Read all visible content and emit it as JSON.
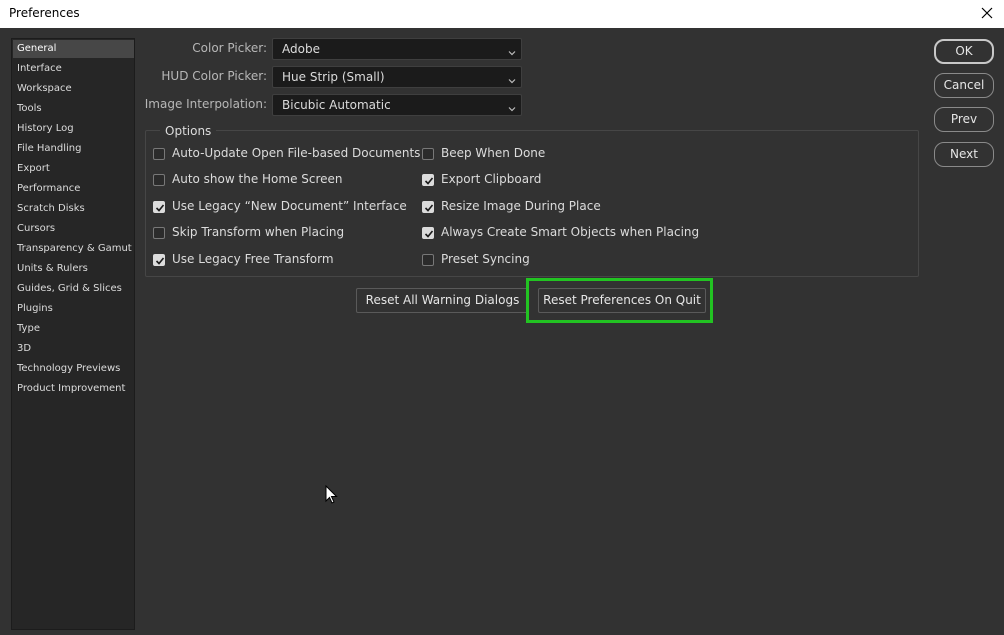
{
  "window": {
    "title": "Preferences"
  },
  "sidebar": {
    "items": [
      {
        "label": "General",
        "selected": true
      },
      {
        "label": "Interface"
      },
      {
        "label": "Workspace"
      },
      {
        "label": "Tools"
      },
      {
        "label": "History Log"
      },
      {
        "label": "File Handling"
      },
      {
        "label": "Export"
      },
      {
        "label": "Performance"
      },
      {
        "label": "Scratch Disks"
      },
      {
        "label": "Cursors"
      },
      {
        "label": "Transparency & Gamut"
      },
      {
        "label": "Units & Rulers"
      },
      {
        "label": "Guides, Grid & Slices"
      },
      {
        "label": "Plugins"
      },
      {
        "label": "Type"
      },
      {
        "label": "3D"
      },
      {
        "label": "Technology Previews"
      },
      {
        "label": "Product Improvement"
      }
    ]
  },
  "fields": {
    "color_picker": {
      "label": "Color Picker:",
      "value": "Adobe"
    },
    "hud_color_picker": {
      "label": "HUD Color Picker:",
      "value": "Hue Strip (Small)"
    },
    "image_interpolation": {
      "label": "Image Interpolation:",
      "value": "Bicubic Automatic"
    }
  },
  "options": {
    "title": "Options",
    "left": [
      {
        "label": "Auto-Update Open File-based Documents",
        "checked": false
      },
      {
        "label": "Auto show the Home Screen",
        "checked": false
      },
      {
        "label": "Use Legacy “New Document” Interface",
        "checked": true
      },
      {
        "label": "Skip Transform when Placing",
        "checked": false
      },
      {
        "label": "Use Legacy Free Transform",
        "checked": true
      }
    ],
    "right": [
      {
        "label": "Beep When Done",
        "checked": false
      },
      {
        "label": "Export Clipboard",
        "checked": true
      },
      {
        "label": "Resize Image During Place",
        "checked": true
      },
      {
        "label": "Always Create Smart Objects when Placing",
        "checked": true
      },
      {
        "label": "Preset Syncing",
        "checked": false
      }
    ]
  },
  "actions": {
    "reset_warnings": "Reset All Warning Dialogs",
    "reset_prefs": "Reset Preferences On Quit"
  },
  "dialog_buttons": {
    "ok": "OK",
    "cancel": "Cancel",
    "prev": "Prev",
    "next": "Next"
  },
  "colors": {
    "background": "#323232",
    "highlight": "#22c322"
  },
  "icons": {
    "close": "close-icon",
    "dropdown": "chevron-down-icon",
    "check": "checkmark-icon",
    "cursor": "mouse-pointer-icon"
  }
}
